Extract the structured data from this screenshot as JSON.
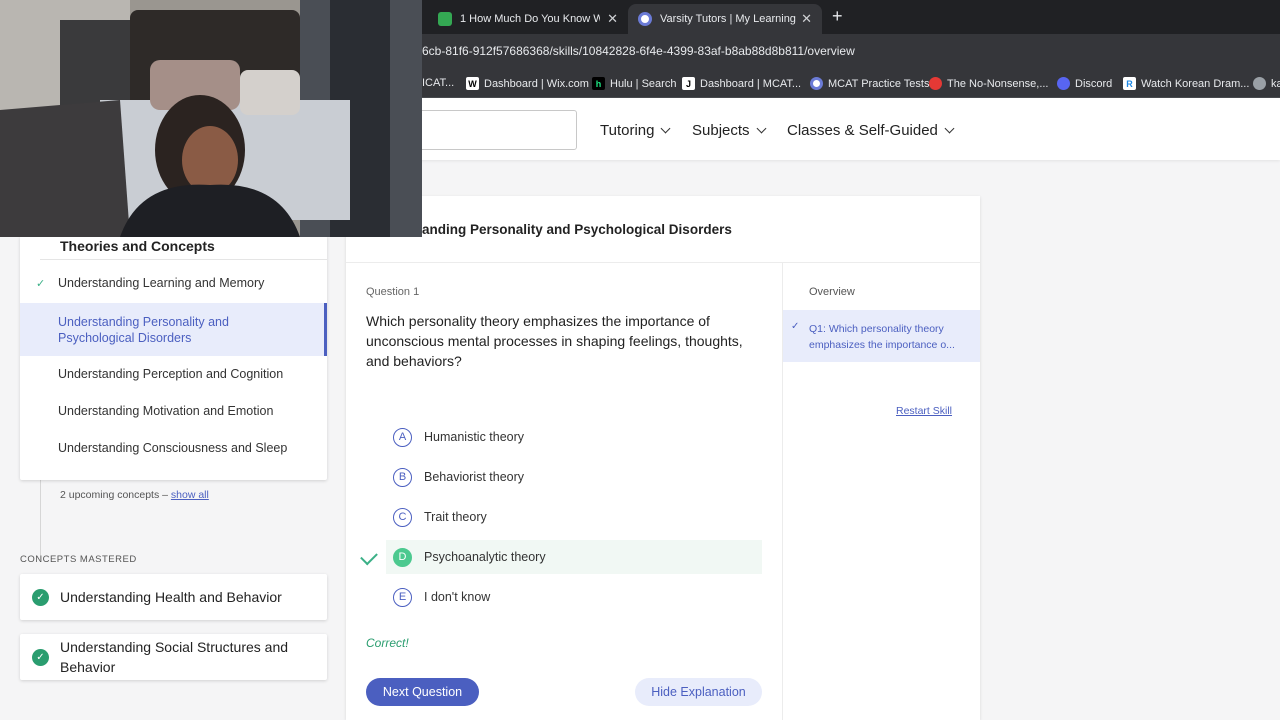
{
  "browser": {
    "tabs": [
      {
        "title": "1 How Much Do You Know Wo",
        "icon_color": "#34a853"
      },
      {
        "title": "Varsity Tutors | My Learning",
        "icon_color": "#e8eaed"
      }
    ],
    "new_tab": "+",
    "close_glyph": "✕",
    "url": "6cb-81f6-912f57686368/skills/10842828-6f4e-4399-83af-b8ab88d8b811/overview",
    "bookmarks": [
      {
        "label": "ICAT...",
        "icon": "",
        "color": "#5f6368"
      },
      {
        "label": "Dashboard | Wix.com",
        "icon": "W",
        "color": "#ffffff"
      },
      {
        "label": "Hulu | Search",
        "icon": "h",
        "color": "#1ce783"
      },
      {
        "label": "Dashboard | MCAT...",
        "icon": "J",
        "color": "#ffffff"
      },
      {
        "label": "MCAT Practice Tests",
        "icon": "",
        "color": "#6b7bd6"
      },
      {
        "label": "The No-Nonsense,...",
        "icon": "",
        "color": "#e53935"
      },
      {
        "label": "Discord",
        "icon": "",
        "color": "#5865f2"
      },
      {
        "label": "Watch Korean Dram...",
        "icon": "R",
        "color": "#1e88e5"
      },
      {
        "label": "ka",
        "icon": "",
        "color": "#9aa0a6"
      }
    ]
  },
  "header": {
    "nav": [
      "Tutoring",
      "Subjects",
      "Classes & Self-Guided"
    ]
  },
  "sidebar": {
    "section_title": "Theories and Concepts",
    "concepts": [
      {
        "label": "Understanding Learning and Memory",
        "done": true
      },
      {
        "label": "Understanding Personality and Psychological Disorders",
        "selected": true
      },
      {
        "label": "Understanding Perception and Cognition"
      },
      {
        "label": "Understanding Motivation and Emotion"
      },
      {
        "label": "Understanding Consciousness and Sleep"
      }
    ],
    "checkmark": "✓",
    "upcoming_text": "2 upcoming concepts – ",
    "show_all": "show all",
    "mastered_heading": "CONCEPTS MASTERED",
    "mastered": [
      "Understanding Health and Behavior",
      "Understanding Social Structures and Behavior"
    ]
  },
  "main": {
    "title": "anding Personality and Psychological Disorders",
    "question_number": "Question 1",
    "question_text": "Which personality theory emphasizes the importance of unconscious mental processes in shaping feelings, thoughts, and behaviors?",
    "answers": [
      {
        "letter": "A",
        "text": "Humanistic theory"
      },
      {
        "letter": "B",
        "text": "Behaviorist theory"
      },
      {
        "letter": "C",
        "text": "Trait theory"
      },
      {
        "letter": "D",
        "text": "Psychoanalytic theory",
        "correct": true
      },
      {
        "letter": "E",
        "text": "I don't know"
      }
    ],
    "feedback": "Correct!",
    "next_button": "Next Question",
    "hide_button": "Hide Explanation",
    "overview": {
      "heading": "Overview",
      "items": [
        "Q1: Which personality theory emphasizes the importance o..."
      ],
      "restart": "Restart Skill"
    }
  },
  "colors": {
    "accent": "#4b5fc0",
    "success": "#2a9d6f"
  }
}
